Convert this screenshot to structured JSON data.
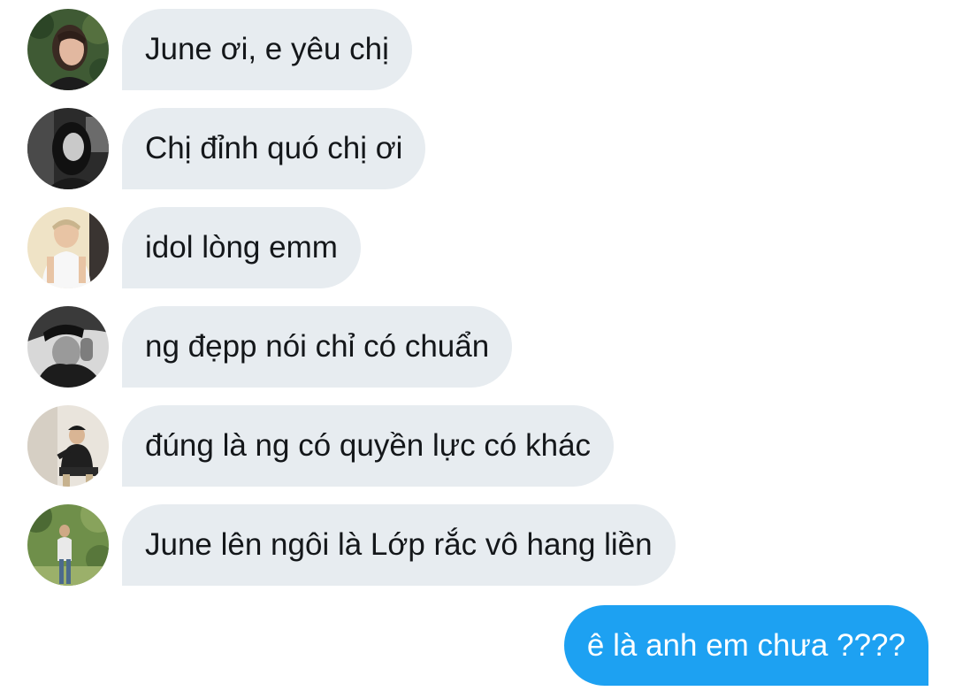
{
  "messages": [
    {
      "text": "June ơi, e yêu chị",
      "avatar": "avatar-photo-woman-leaves"
    },
    {
      "text": "Chị đỉnh quó chị ơi",
      "avatar": "avatar-photo-woman-bw"
    },
    {
      "text": "idol lòng emm",
      "avatar": "avatar-photo-man-light"
    },
    {
      "text": "ng đẹpp nói chỉ có chuẩn",
      "avatar": "avatar-photo-man-bw"
    },
    {
      "text": "đúng là ng có quyền lực có khác",
      "avatar": "avatar-photo-man-sitting"
    },
    {
      "text": "June lên ngôi là Lớp rắc vô hang liền",
      "avatar": "avatar-photo-man-garden"
    }
  ],
  "outgoing": {
    "text": "ê là anh em chưa ????"
  },
  "colors": {
    "incoming_bubble": "#e7ecf0",
    "incoming_text": "#14171a",
    "outgoing_bubble": "#1da1f2",
    "outgoing_text": "#ffffff"
  }
}
